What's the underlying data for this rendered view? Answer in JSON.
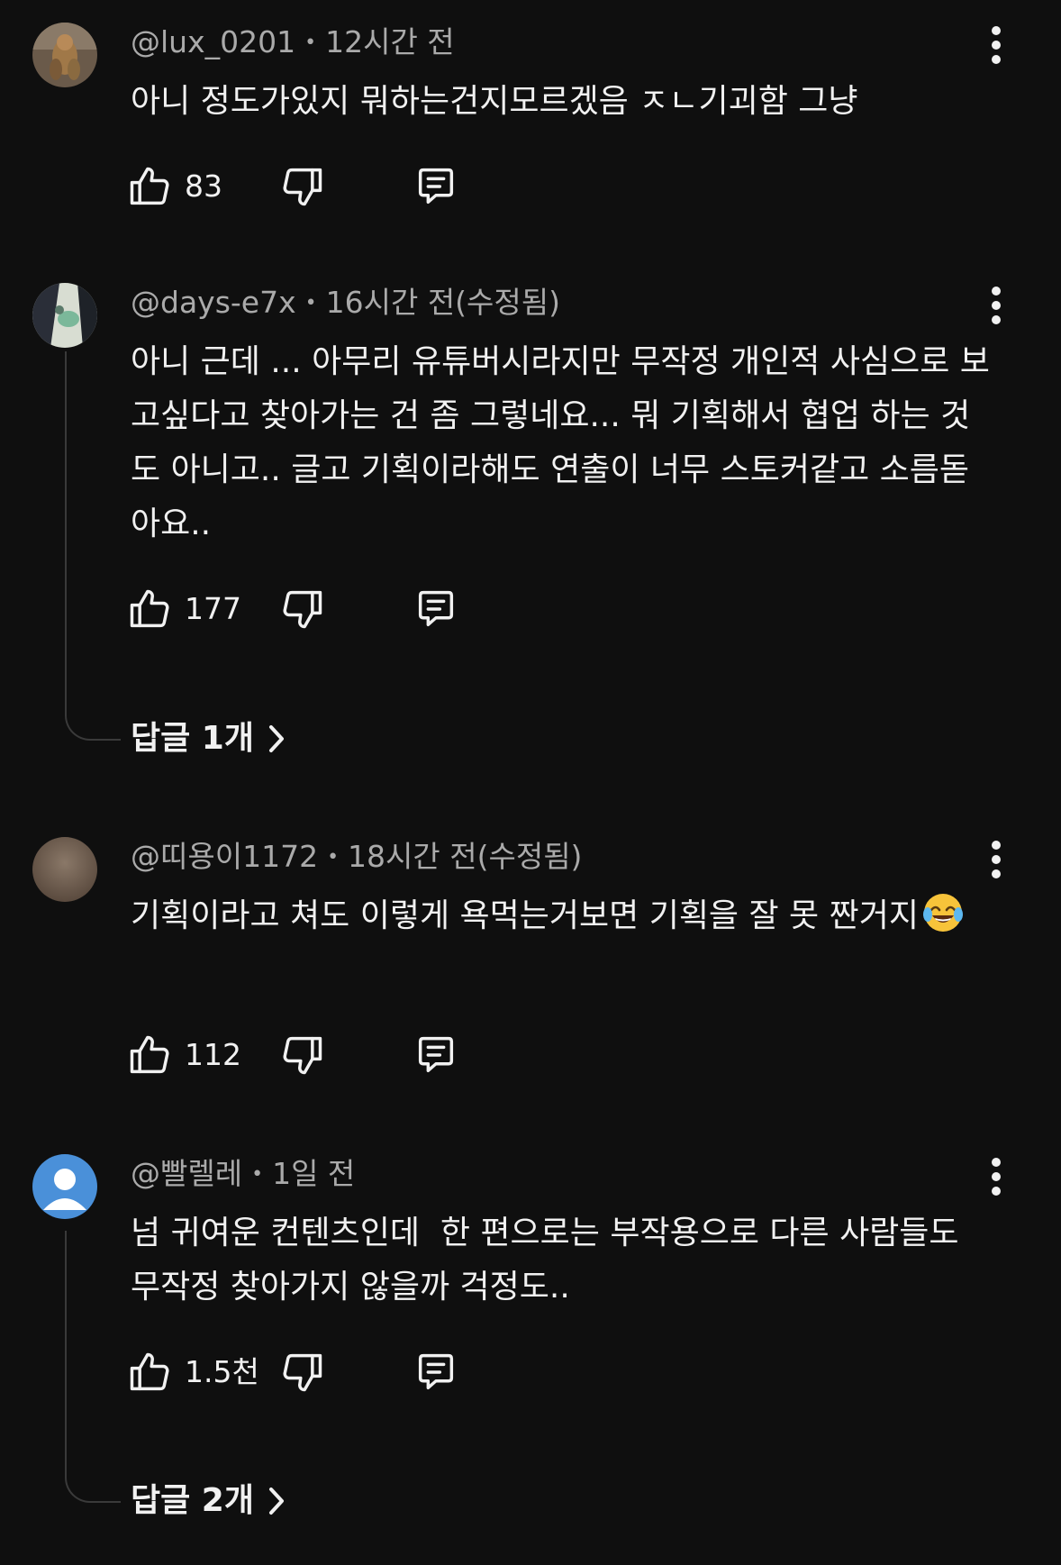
{
  "comments": [
    {
      "author": "@lux_0201",
      "time": "12시간 전",
      "text": "아니 정도가있지 뭐하는건지모르겠음 ㅈㄴ기괴함 그냥",
      "likes": "83",
      "avatar": "photo-figurine"
    },
    {
      "author": "@days-e7x",
      "time": "16시간 전(수정됨)",
      "text": "아니 근데 ... 아무리 유튜버시라지만 무작정 개인적 사심으로 보고싶다고 찾아가는 건 좀 그렇네요... 뭐 기획해서 협업 하는 것도 아니고.. 글고 기획이라해도 연출이 너무 스토커같고 소름돋아요..",
      "likes": "177",
      "avatar": "photo-art",
      "replies": "답글 1개"
    },
    {
      "author": "@띠용이1172",
      "time": "18시간 전(수정됨)",
      "text": "기획이라고 쳐도 이렇게 욕먹는거보면 기획을 잘 못 짠거지",
      "emoji": "face-with-tears-of-joy",
      "likes": "112",
      "avatar": "blurred-brown"
    },
    {
      "author": "@빨렐레",
      "time": "1일 전",
      "text": "넘 귀여운 컨텐츠인데  한 편으로는 부작용으로 다른 사람들도 무작정 찾아가지 않을까 걱정도..",
      "likes": "1.5천",
      "avatar": "default-person",
      "replies": "답글 2개"
    }
  ],
  "colors": {
    "background": "#0f0f0f",
    "text": "#f1f1f1",
    "meta": "#aaaaaa",
    "default_avatar_bg": "#4a90d9"
  },
  "icons": [
    "like-icon",
    "dislike-icon",
    "reply-icon",
    "more-options-icon",
    "chevron-right-icon"
  ]
}
